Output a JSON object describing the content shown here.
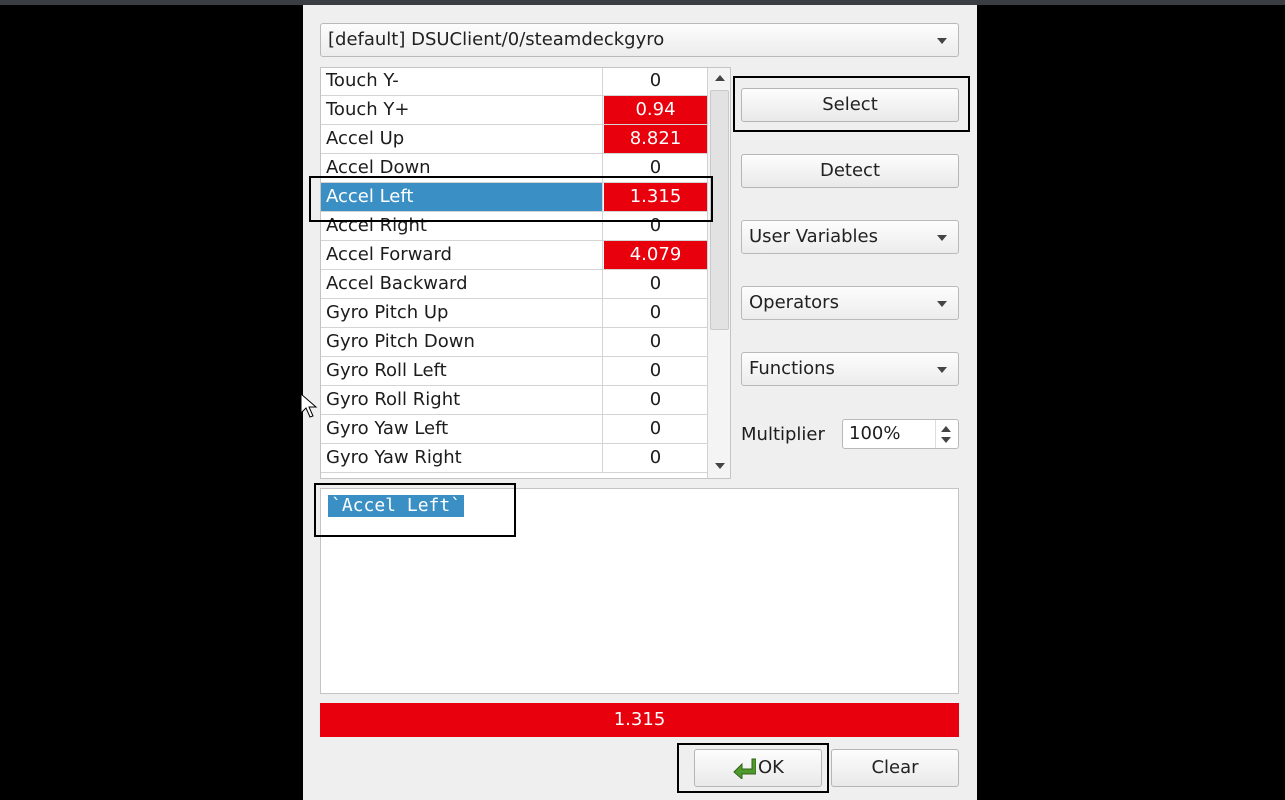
{
  "device": {
    "selected": "[default] DSUClient/0/steamdeckgyro"
  },
  "inputs": [
    {
      "name": "Touch Y-",
      "value": "0",
      "active": false
    },
    {
      "name": "Touch Y+",
      "value": "0.94",
      "active": true
    },
    {
      "name": "Accel Up",
      "value": "8.821",
      "active": true
    },
    {
      "name": "Accel Down",
      "value": "0",
      "active": false
    },
    {
      "name": "Accel Left",
      "value": "1.315",
      "active": true,
      "selected": true
    },
    {
      "name": "Accel Right",
      "value": "0",
      "active": false
    },
    {
      "name": "Accel Forward",
      "value": "4.079",
      "active": true
    },
    {
      "name": "Accel Backward",
      "value": "0",
      "active": false
    },
    {
      "name": "Gyro Pitch Up",
      "value": "0",
      "active": false
    },
    {
      "name": "Gyro Pitch Down",
      "value": "0",
      "active": false
    },
    {
      "name": "Gyro Roll Left",
      "value": "0",
      "active": false
    },
    {
      "name": "Gyro Roll Right",
      "value": "0",
      "active": false
    },
    {
      "name": "Gyro Yaw Left",
      "value": "0",
      "active": false
    },
    {
      "name": "Gyro Yaw Right",
      "value": "0",
      "active": false
    }
  ],
  "buttons": {
    "select": "Select",
    "detect": "Detect",
    "ok": "OK",
    "clear": "Clear"
  },
  "menus": {
    "user_variables": "User Variables",
    "operators": "Operators",
    "functions": "Functions"
  },
  "multiplier": {
    "label": "Multiplier",
    "value": "100%"
  },
  "expression": "`Accel Left`",
  "result_value": "1.315",
  "colors": {
    "active": "#e8000c",
    "selection": "#3a8fc4"
  }
}
